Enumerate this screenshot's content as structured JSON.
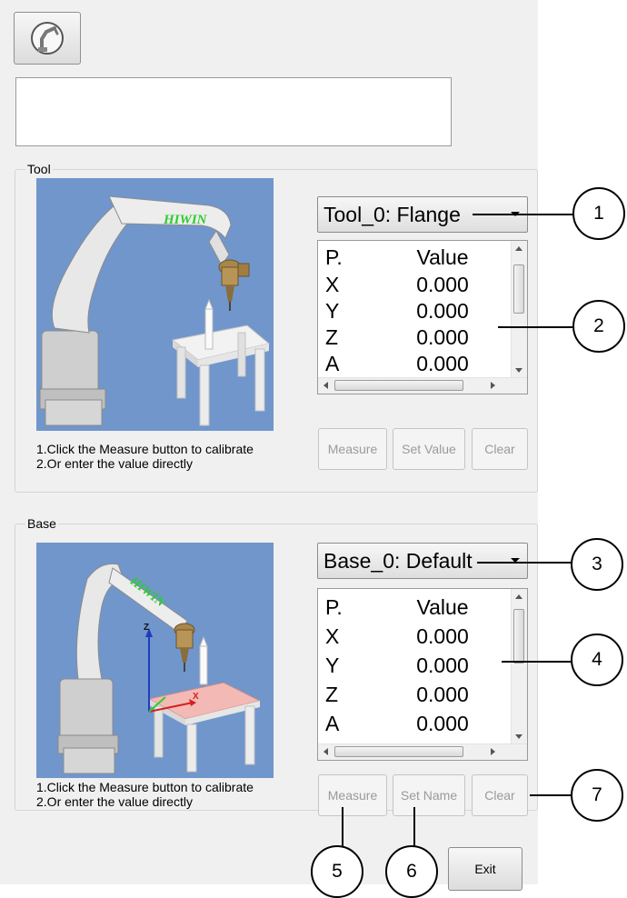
{
  "top_button": {
    "icon": "robot-arm-icon"
  },
  "message_box": {
    "text": ""
  },
  "tool": {
    "group_label": "Tool",
    "brand": "HIWIN",
    "dropdown_value": "Tool_0: Flange",
    "table": {
      "header": {
        "param": "P.",
        "value": "Value"
      },
      "rows": [
        {
          "param": "X",
          "value": "0.000"
        },
        {
          "param": "Y",
          "value": "0.000"
        },
        {
          "param": "Z",
          "value": "0.000"
        },
        {
          "param": "A",
          "value": "0.000"
        }
      ]
    },
    "hint_line1": "1.Click the Measure button to calibrate",
    "hint_line2": "2.Or enter the value directly",
    "buttons": {
      "measure": "Measure",
      "set_value": "Set Value",
      "clear": "Clear"
    }
  },
  "base": {
    "group_label": "Base",
    "brand": "HIWIN",
    "axes": {
      "z": "Z",
      "x": "X"
    },
    "dropdown_value": "Base_0: Default",
    "table": {
      "header": {
        "param": "P.",
        "value": "Value"
      },
      "rows": [
        {
          "param": "X",
          "value": "0.000"
        },
        {
          "param": "Y",
          "value": "0.000"
        },
        {
          "param": "Z",
          "value": "0.000"
        },
        {
          "param": "A",
          "value": "0.000"
        }
      ]
    },
    "hint_line1": "1.Click the Measure button to calibrate",
    "hint_line2": "2.Or enter the value directly",
    "buttons": {
      "measure": "Measure",
      "set_name": "Set Name",
      "clear": "Clear"
    }
  },
  "exit_label": "Exit",
  "callouts": [
    "1",
    "2",
    "3",
    "4",
    "5",
    "6",
    "7"
  ],
  "colors": {
    "picture_bg": "#7096cc",
    "brand_green": "#2ecc2e",
    "panel_bg": "#f0f0f0"
  }
}
